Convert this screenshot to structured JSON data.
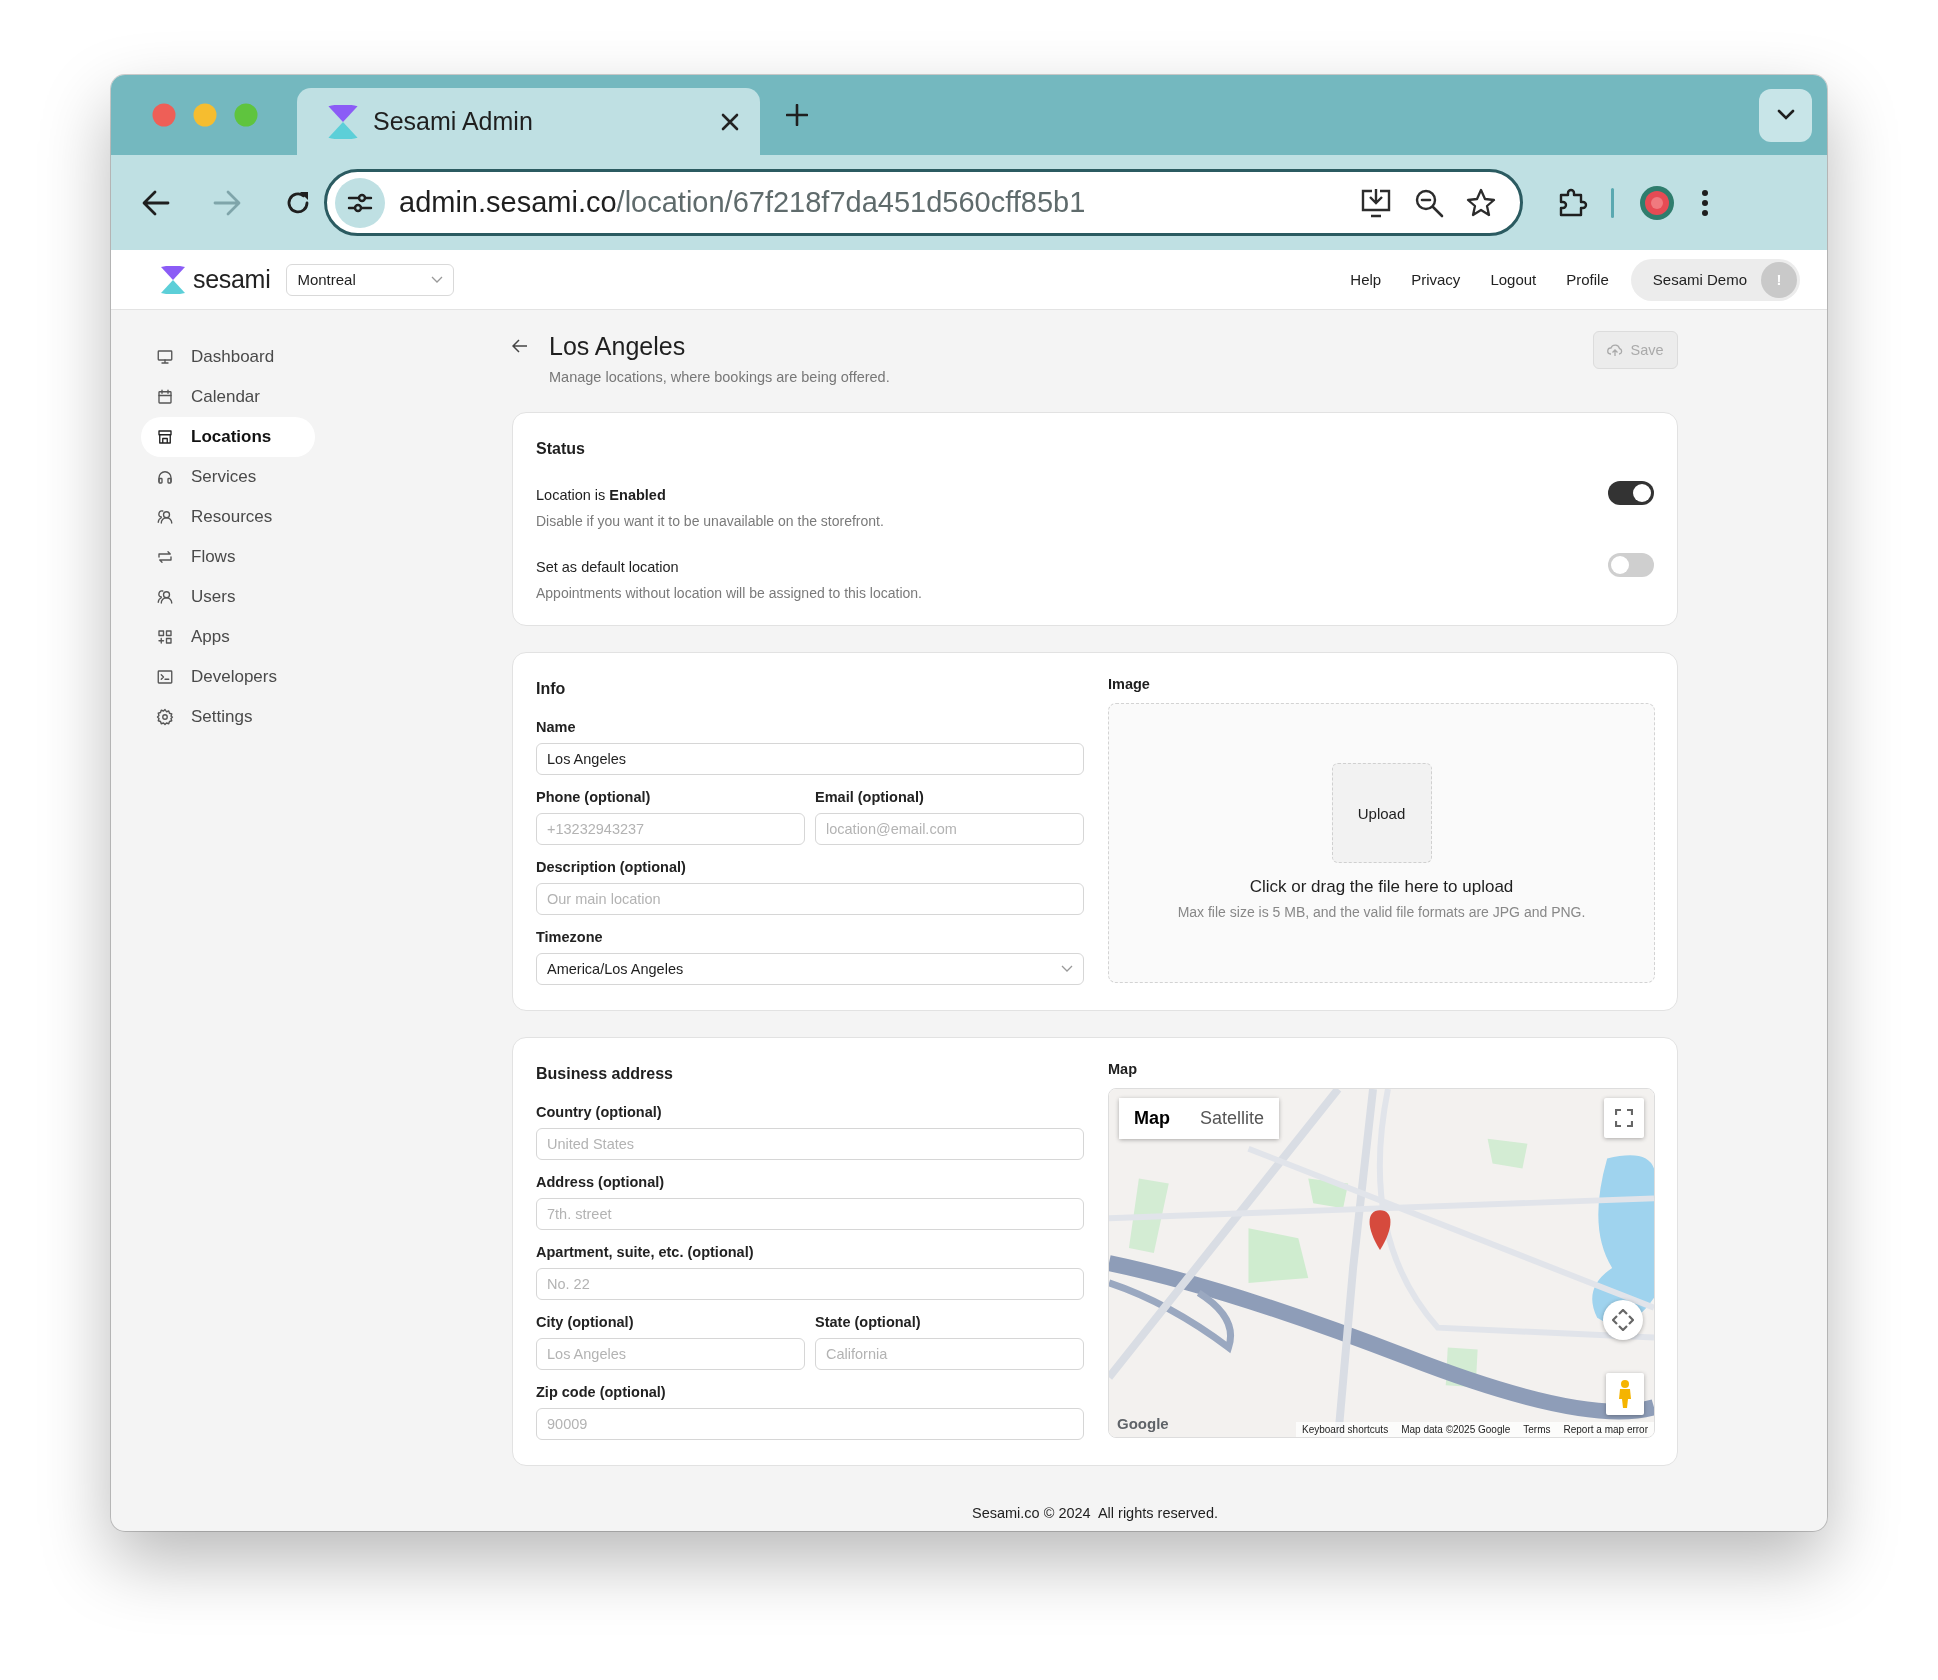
{
  "browser": {
    "tab": {
      "title": "Sesami Admin"
    },
    "forward": {
      "disabled": true
    },
    "address_bar": {
      "host": "admin.sesami.co",
      "path": "/location/67f218f7da451d560cff85b1"
    }
  },
  "header": {
    "brand": "sesami",
    "location_select": {
      "value": "Montreal"
    },
    "nav": [
      "Help",
      "Privacy",
      "Logout",
      "Profile"
    ],
    "user": {
      "name": "Sesami Demo",
      "badge": "!"
    }
  },
  "sidebar": {
    "items": [
      {
        "label": "Dashboard",
        "selected": false
      },
      {
        "label": "Calendar",
        "selected": false
      },
      {
        "label": "Locations",
        "selected": true
      },
      {
        "label": "Services",
        "selected": false
      },
      {
        "label": "Resources",
        "selected": false
      },
      {
        "label": "Flows",
        "selected": false
      },
      {
        "label": "Users",
        "selected": false
      },
      {
        "label": "Apps",
        "selected": false
      },
      {
        "label": "Developers",
        "selected": false
      },
      {
        "label": "Settings",
        "selected": false
      }
    ]
  },
  "page": {
    "title": "Los Angeles",
    "subtitle": "Manage locations, where bookings are being offered.",
    "save_button": {
      "label": "Save",
      "disabled": true
    }
  },
  "status": {
    "heading": "Status",
    "toggles": [
      {
        "label": "Location is **Enabled**",
        "description": "Disable if you want it to be unavailable on the storefront.",
        "on": true
      },
      {
        "label": "Set as default location",
        "description": "Appointments without location will be assigned to this location.",
        "on": false
      }
    ]
  },
  "info": {
    "heading": "Info",
    "rows": [
      [
        {
          "kind": "text",
          "label": "Name",
          "value": "Los Angeles"
        }
      ],
      [
        {
          "kind": "text",
          "label": "Phone (optional)",
          "placeholder": "+13232943237"
        },
        {
          "kind": "text",
          "label": "Email (optional)",
          "placeholder": "location@email.com"
        }
      ],
      [
        {
          "kind": "text",
          "label": "Description (optional)",
          "placeholder": "Our main location"
        }
      ],
      [
        {
          "kind": "select",
          "label": "Timezone",
          "value": "America/Los Angeles"
        }
      ]
    ],
    "image": {
      "label": "Image",
      "upload_button": "Upload",
      "prompt": "Click or drag the file here to upload",
      "hint": "Max file size is 5 MB, and the valid file formats are JPG and PNG."
    }
  },
  "business_address": {
    "heading": "Business address",
    "rows": [
      [
        {
          "kind": "text",
          "label": "Country (optional)",
          "placeholder": "United States"
        }
      ],
      [
        {
          "kind": "text",
          "label": "Address (optional)",
          "placeholder": "7th. street"
        }
      ],
      [
        {
          "kind": "text",
          "label": "Apartment, suite, etc. (optional)",
          "placeholder": "No. 22"
        }
      ],
      [
        {
          "kind": "text",
          "label": "City (optional)",
          "placeholder": "Los Angeles"
        },
        {
          "kind": "text",
          "label": "State (optional)",
          "placeholder": "California"
        }
      ],
      [
        {
          "kind": "text",
          "label": "Zip code (optional)",
          "placeholder": "90009"
        }
      ]
    ],
    "map": {
      "label": "Map",
      "map_types": [
        {
          "label": "Map",
          "selected": true
        },
        {
          "label": "Satellite",
          "selected": false
        }
      ],
      "logo": "Google",
      "attribution": [
        "Keyboard shortcuts",
        "Map data ©2025 Google",
        "Terms",
        "Report a map error"
      ]
    }
  },
  "footer": "Sesami.co © 2024  All rights reserved."
}
